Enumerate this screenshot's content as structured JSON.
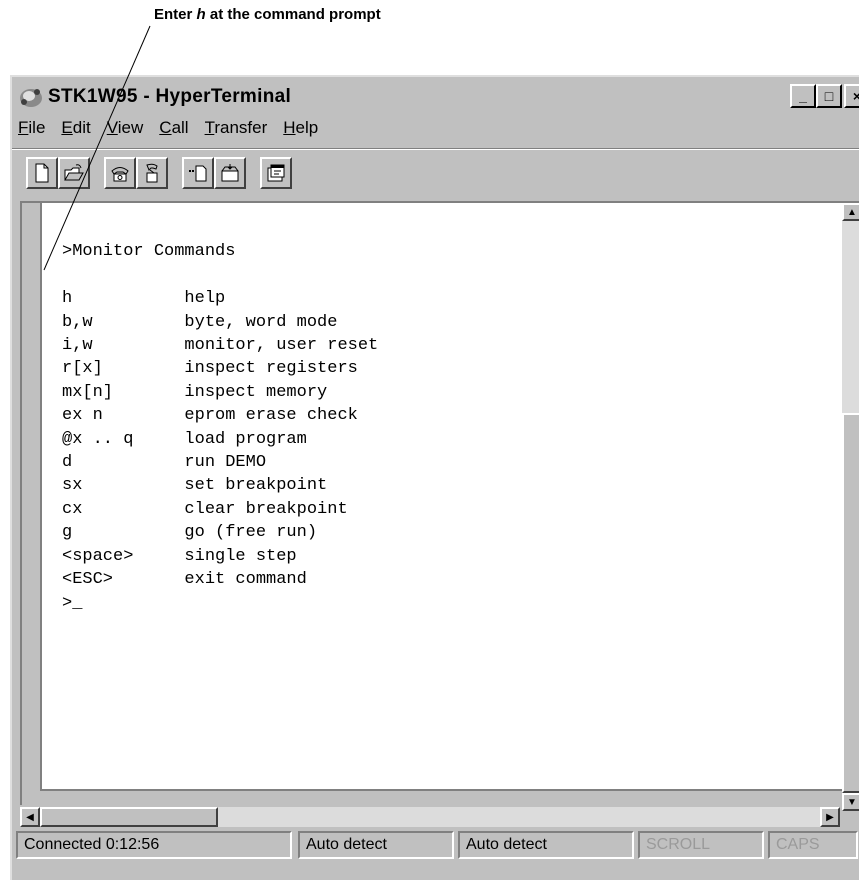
{
  "annotation": {
    "prefix": "Enter ",
    "emphasis": "h",
    "suffix": " at the command prompt"
  },
  "window": {
    "title": "STK1W95 - HyperTerminal",
    "controls": {
      "minimize": "_",
      "maximize": "□",
      "close": "×"
    }
  },
  "menu": [
    {
      "accel": "F",
      "rest": "ile"
    },
    {
      "accel": "E",
      "rest": "dit"
    },
    {
      "accel": "V",
      "rest": "iew"
    },
    {
      "accel": "C",
      "rest": "all"
    },
    {
      "accel": "T",
      "rest": "ransfer"
    },
    {
      "accel": "H",
      "rest": "elp"
    }
  ],
  "toolbar": {
    "icons": [
      "new-icon",
      "open-icon",
      "call-icon",
      "disconnect-icon",
      "send-icon",
      "receive-icon",
      "properties-icon"
    ]
  },
  "terminal": {
    "lines": [
      ">Monitor Commands",
      "",
      "h           help",
      "b,w         byte, word mode",
      "i,w         monitor, user reset",
      "r[x]        inspect registers",
      "mx[n]       inspect memory",
      "ex n        eprom erase check",
      "@x .. q     load program",
      "d           run DEMO",
      "sx          set breakpoint",
      "cx          clear breakpoint",
      "g           go (free run)",
      "<space>     single step",
      "<ESC>       exit command",
      ">_"
    ]
  },
  "statusbar": {
    "connected": "Connected 0:12:56",
    "detect1": "Auto detect",
    "detect2": "Auto detect",
    "scroll": "SCROLL",
    "caps": "CAPS"
  }
}
